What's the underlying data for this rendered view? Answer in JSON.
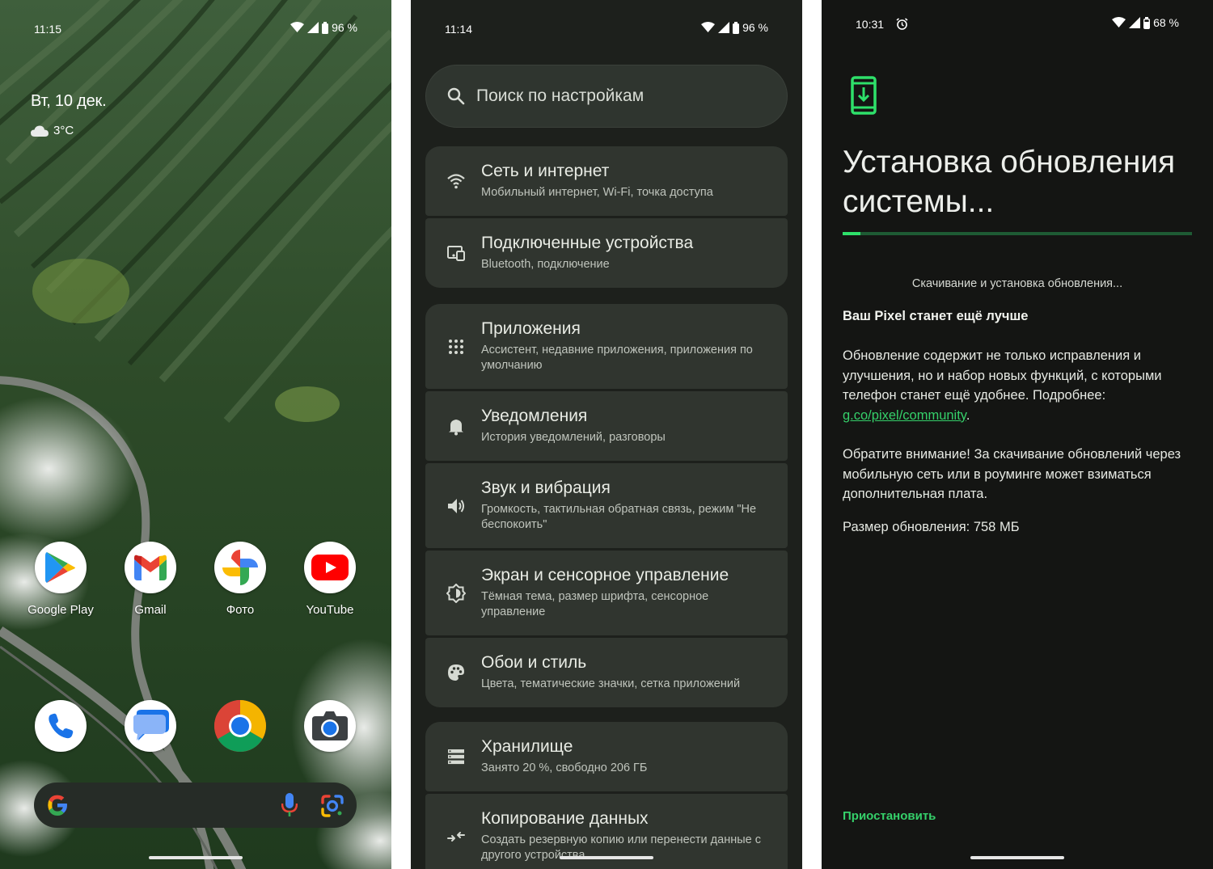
{
  "home": {
    "status": {
      "time": "11:15",
      "battery": "96 %"
    },
    "date": "Вт, 10 дек.",
    "weather": {
      "temp": "3°C",
      "icon": "cloud-icon"
    },
    "apps_row1": [
      {
        "label": "Google Play",
        "icon": "google-play-icon"
      },
      {
        "label": "Gmail",
        "icon": "gmail-icon"
      },
      {
        "label": "Фото",
        "icon": "photos-icon"
      },
      {
        "label": "YouTube",
        "icon": "youtube-icon"
      }
    ],
    "dock": [
      "phone-icon",
      "messages-icon",
      "chrome-icon",
      "camera-icon"
    ],
    "search_bar": {
      "icons": [
        "google-g-icon",
        "mic-icon",
        "lens-icon"
      ]
    }
  },
  "settings": {
    "status": {
      "time": "11:14",
      "battery": "96 %"
    },
    "search_placeholder": "Поиск по настройкам",
    "items": [
      {
        "title": "Сеть и интернет",
        "subtitle": "Мобильный интернет, Wi-Fi, точка доступа",
        "icon": "wifi-icon"
      },
      {
        "title": "Подключенные устройства",
        "subtitle": "Bluetooth, подключение",
        "icon": "devices-icon"
      },
      {
        "title": "Приложения",
        "subtitle": "Ассистент, недавние приложения, приложения по умолчанию",
        "icon": "apps-grid-icon"
      },
      {
        "title": "Уведомления",
        "subtitle": "История уведомлений, разговоры",
        "icon": "bell-icon"
      },
      {
        "title": "Звук и вибрация",
        "subtitle": "Громкость, тактильная обратная связь, режим \"Не беспокоить\"",
        "icon": "speaker-icon"
      },
      {
        "title": "Экран и сенсорное управление",
        "subtitle": "Тёмная тема, размер шрифта, сенсорное управление",
        "icon": "brightness-icon"
      },
      {
        "title": "Обои и стиль",
        "subtitle": "Цвета, тематические значки, сетка приложений",
        "icon": "palette-icon"
      },
      {
        "title": "Хранилище",
        "subtitle": "Занято 20 %, свободно 206 ГБ",
        "icon": "storage-icon"
      },
      {
        "title": "Копирование данных",
        "subtitle": "Создать резервную копию или перенести данные с другого устройства",
        "icon": "backup-icon"
      }
    ]
  },
  "update": {
    "status": {
      "time": "10:31",
      "battery": "68 %"
    },
    "title": "Установка обновления системы...",
    "progress": 0.05,
    "status_text": "Скачивание и установка обновления...",
    "headline": "Ваш Pixel станет ещё лучше",
    "p1": "Обновление содержит не только исправления и улучшения, но и набор новых функций, с которыми телефон станет ещё удобнее. Подробнее: ",
    "p1_link": "g.co/pixel/community",
    "p1_end": ".",
    "p2": "Обратите внимание! За скачивание обновлений через мобильную сеть или в роуминге может взиматься дополнительная плата.",
    "size": "Размер обновления: 758 МБ",
    "pause_button": "Приостановить"
  },
  "colors": {
    "accent_green": "#35d06a",
    "settings_bg": "#1d201c",
    "settings_card": "#30352f"
  }
}
